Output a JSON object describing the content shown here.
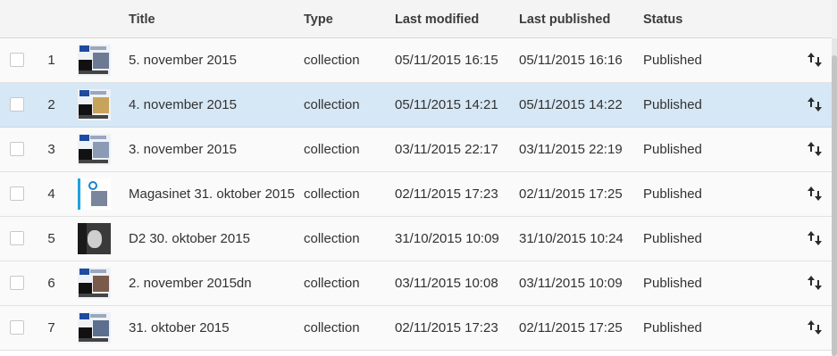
{
  "header": {
    "title": "Title",
    "type": "Type",
    "last_modified": "Last modified",
    "last_published": "Last published",
    "status": "Status"
  },
  "rows": [
    {
      "num": "1",
      "title": "5. november 2015",
      "type": "collection",
      "modified": "05/11/2015 16:15",
      "published": "05/11/2015 16:16",
      "status": "Published",
      "thumb": "newspaper",
      "selected": false
    },
    {
      "num": "2",
      "title": "4. november 2015",
      "type": "collection",
      "modified": "05/11/2015 14:21",
      "published": "05/11/2015 14:22",
      "status": "Published",
      "thumb": "newspaper",
      "selected": true
    },
    {
      "num": "3",
      "title": "3. november 2015",
      "type": "collection",
      "modified": "03/11/2015 22:17",
      "published": "03/11/2015 22:19",
      "status": "Published",
      "thumb": "newspaper",
      "selected": false
    },
    {
      "num": "4",
      "title": "Magasinet 31. oktober 2015",
      "type": "collection",
      "modified": "02/11/2015 17:23",
      "published": "02/11/2015 17:25",
      "status": "Published",
      "thumb": "magazine",
      "selected": false
    },
    {
      "num": "5",
      "title": "D2 30. oktober 2015",
      "type": "collection",
      "modified": "31/10/2015 10:09",
      "published": "31/10/2015 10:24",
      "status": "Published",
      "thumb": "photo-bw",
      "selected": false
    },
    {
      "num": "6",
      "title": "2. november 2015dn",
      "type": "collection",
      "modified": "03/11/2015 10:08",
      "published": "03/11/2015 10:09",
      "status": "Published",
      "thumb": "newspaper",
      "selected": false
    },
    {
      "num": "7",
      "title": "31. oktober 2015",
      "type": "collection",
      "modified": "02/11/2015 17:23",
      "published": "02/11/2015 17:25",
      "status": "Published",
      "thumb": "newspaper",
      "selected": false
    }
  ],
  "icons": {
    "row_action": "reorder-arrows-icon"
  },
  "colors": {
    "selected_row": "#d6e7f5",
    "header_bg": "#f4f4f4",
    "text": "#323232"
  }
}
